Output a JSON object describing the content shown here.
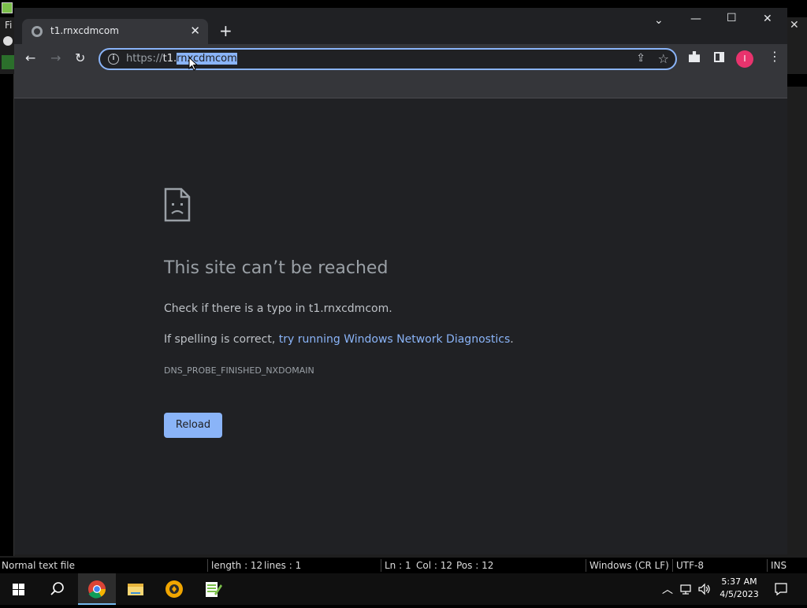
{
  "background_app": {
    "menu_partial": "Fi",
    "status": {
      "file_type": "Normal text file",
      "length": "length : 12",
      "lines": "lines : 1",
      "ln": "Ln : 1",
      "col": "Col : 12",
      "pos": "Pos : 12",
      "eol": "Windows (CR LF)",
      "encoding": "UTF-8",
      "mode": "INS"
    }
  },
  "browser": {
    "tab": {
      "title": "t1.rnxcdmcom"
    },
    "window_controls": {
      "list": "⌄",
      "minimize": "—",
      "maximize": "☐",
      "close": "✕"
    },
    "toolbar": {
      "back": "←",
      "forward": "→",
      "reload": "↻"
    },
    "omnibox": {
      "scheme": "https://",
      "host_plain": "t1.",
      "host_selected": "rnxcdmcom"
    },
    "profile_initial": "I"
  },
  "error_page": {
    "title": "This site can’t be reached",
    "line1": "Check if there is a typo in t1.rnxcdmcom.",
    "line2_prefix": "If spelling is correct, ",
    "line2_link": "try running Windows Network Diagnostics",
    "line2_suffix": ".",
    "code": "DNS_PROBE_FINISHED_NXDOMAIN",
    "reload_label": "Reload"
  },
  "taskbar": {
    "time": "5:37 AM",
    "date": "4/5/2023"
  }
}
